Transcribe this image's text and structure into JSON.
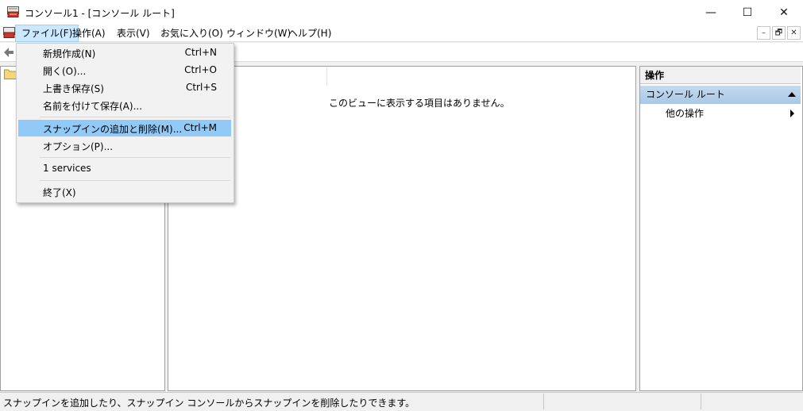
{
  "window": {
    "title": "コンソール1 - [コンソール ルート]",
    "minimize_glyph": "—",
    "maximize_glyph": "☐",
    "close_glyph": "✕"
  },
  "menubar": {
    "items": [
      {
        "label": "ファイル(F)",
        "active": true
      },
      {
        "label": "操作(A)"
      },
      {
        "label": "表示(V)"
      },
      {
        "label": "お気に入り(O)"
      },
      {
        "label": "ウィンドウ(W)"
      },
      {
        "label": "ヘルプ(H)"
      }
    ],
    "mdi": {
      "minimize": "–",
      "restore": "🗗",
      "close": "✕"
    }
  },
  "file_menu": {
    "items": [
      {
        "label": "新規作成(N)",
        "shortcut": "Ctrl+N"
      },
      {
        "label": "開く(O)...",
        "shortcut": "Ctrl+O"
      },
      {
        "label": "上書き保存(S)",
        "shortcut": "Ctrl+S"
      },
      {
        "label": "名前を付けて保存(A)...",
        "shortcut": ""
      },
      {
        "label": "スナップインの追加と削除(M)...",
        "shortcut": "Ctrl+M",
        "highlighted": true
      },
      {
        "label": "オプション(P)...",
        "shortcut": ""
      },
      {
        "label": "1 services",
        "shortcut": ""
      },
      {
        "label": "終了(X)",
        "shortcut": ""
      }
    ]
  },
  "center_pane": {
    "empty_message": "このビューに表示する項目はありません。"
  },
  "actions_pane": {
    "header": "操作",
    "section": "コンソール ルート",
    "items": [
      "他の操作"
    ]
  },
  "statusbar": {
    "text": "スナップインを追加したり、スナップイン コンソールからスナップインを削除したりできます。"
  },
  "colors": {
    "highlight": "#91c9f7",
    "menu_active": "#cce8ff",
    "section_header": "#b5d0ea"
  }
}
